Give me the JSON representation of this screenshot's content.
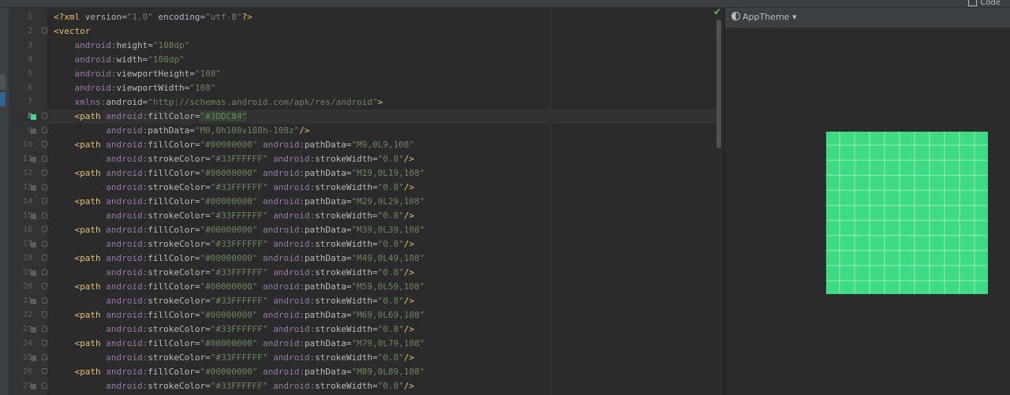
{
  "top_bar": {
    "button_label": "Code"
  },
  "preview": {
    "theme_label": "AppTheme",
    "theme_chevron": "▾",
    "fill_color": "#3DDC84",
    "grid_line_color": "#33FFFFFF"
  },
  "editor": {
    "current_line": 8,
    "lines": [
      {
        "n": "1",
        "code": "<?xml version=\"1.0\" encoding=\"utf-8\"?>"
      },
      {
        "n": "2",
        "code": "<vector"
      },
      {
        "n": "3",
        "code": "    android:height=\"108dp\""
      },
      {
        "n": "4",
        "code": "    android:width=\"108dp\""
      },
      {
        "n": "5",
        "code": "    android:viewportHeight=\"108\""
      },
      {
        "n": "6",
        "code": "    android:viewportWidth=\"108\""
      },
      {
        "n": "7",
        "code": "    xmlns:android=\"http://schemas.android.com/apk/res/android\">"
      },
      {
        "n": "8",
        "code": "    <path android:fillColor=\"#3DDC84\""
      },
      {
        "n": "9",
        "code": "          android:pathData=\"M0,0h108v108h-108z\"/>"
      },
      {
        "n": "10",
        "code": "    <path android:fillColor=\"#00000000\" android:pathData=\"M9,0L9,108\""
      },
      {
        "n": "11",
        "code": "          android:strokeColor=\"#33FFFFFF\" android:strokeWidth=\"0.8\"/>"
      },
      {
        "n": "12",
        "code": "    <path android:fillColor=\"#00000000\" android:pathData=\"M19,0L19,108\""
      },
      {
        "n": "13",
        "code": "          android:strokeColor=\"#33FFFFFF\" android:strokeWidth=\"0.8\"/>"
      },
      {
        "n": "14",
        "code": "    <path android:fillColor=\"#00000000\" android:pathData=\"M29,0L29,108\""
      },
      {
        "n": "15",
        "code": "          android:strokeColor=\"#33FFFFFF\" android:strokeWidth=\"0.8\"/>"
      },
      {
        "n": "16",
        "code": "    <path android:fillColor=\"#00000000\" android:pathData=\"M39,0L39,108\""
      },
      {
        "n": "17",
        "code": "          android:strokeColor=\"#33FFFFFF\" android:strokeWidth=\"0.8\"/>"
      },
      {
        "n": "18",
        "code": "    <path android:fillColor=\"#00000000\" android:pathData=\"M49,0L49,108\""
      },
      {
        "n": "19",
        "code": "          android:strokeColor=\"#33FFFFFF\" android:strokeWidth=\"0.8\"/>"
      },
      {
        "n": "20",
        "code": "    <path android:fillColor=\"#00000000\" android:pathData=\"M59,0L59,108\""
      },
      {
        "n": "21",
        "code": "          android:strokeColor=\"#33FFFFFF\" android:strokeWidth=\"0.8\"/>"
      },
      {
        "n": "22",
        "code": "    <path android:fillColor=\"#00000000\" android:pathData=\"M69,0L69,108\""
      },
      {
        "n": "23",
        "code": "          android:strokeColor=\"#33FFFFFF\" android:strokeWidth=\"0.8\"/>"
      },
      {
        "n": "24",
        "code": "    <path android:fillColor=\"#00000000\" android:pathData=\"M79,0L79,108\""
      },
      {
        "n": "25",
        "code": "          android:strokeColor=\"#33FFFFFF\" android:strokeWidth=\"0.8\"/>"
      },
      {
        "n": "26",
        "code": "    <path android:fillColor=\"#00000000\" android:pathData=\"M89,0L89,108\""
      },
      {
        "n": "27",
        "code": "          android:strokeColor=\"#33FFFFFF\" android:strokeWidth=\"0.8\"/>"
      }
    ]
  }
}
